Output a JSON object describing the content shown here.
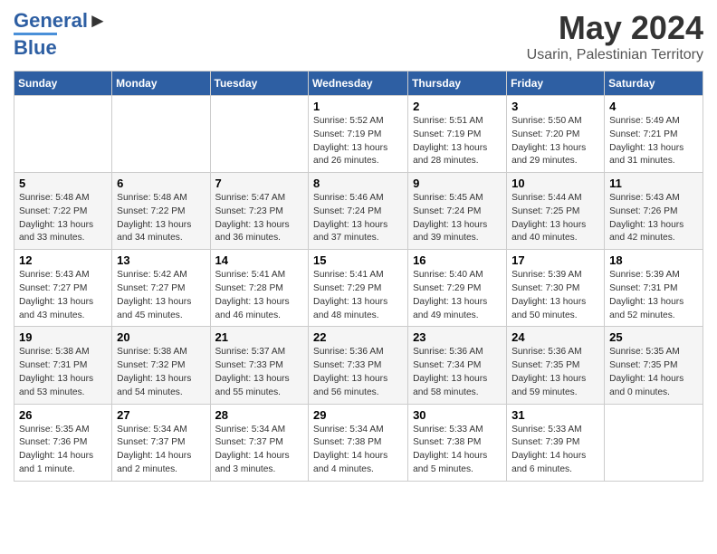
{
  "logo": {
    "line1": "General",
    "line2": "Blue"
  },
  "title": "May 2024",
  "subtitle": "Usarin, Palestinian Territory",
  "days_of_week": [
    "Sunday",
    "Monday",
    "Tuesday",
    "Wednesday",
    "Thursday",
    "Friday",
    "Saturday"
  ],
  "weeks": [
    [
      {
        "day": "",
        "info": ""
      },
      {
        "day": "",
        "info": ""
      },
      {
        "day": "",
        "info": ""
      },
      {
        "day": "1",
        "info": "Sunrise: 5:52 AM\nSunset: 7:19 PM\nDaylight: 13 hours\nand 26 minutes."
      },
      {
        "day": "2",
        "info": "Sunrise: 5:51 AM\nSunset: 7:19 PM\nDaylight: 13 hours\nand 28 minutes."
      },
      {
        "day": "3",
        "info": "Sunrise: 5:50 AM\nSunset: 7:20 PM\nDaylight: 13 hours\nand 29 minutes."
      },
      {
        "day": "4",
        "info": "Sunrise: 5:49 AM\nSunset: 7:21 PM\nDaylight: 13 hours\nand 31 minutes."
      }
    ],
    [
      {
        "day": "5",
        "info": "Sunrise: 5:48 AM\nSunset: 7:22 PM\nDaylight: 13 hours\nand 33 minutes."
      },
      {
        "day": "6",
        "info": "Sunrise: 5:48 AM\nSunset: 7:22 PM\nDaylight: 13 hours\nand 34 minutes."
      },
      {
        "day": "7",
        "info": "Sunrise: 5:47 AM\nSunset: 7:23 PM\nDaylight: 13 hours\nand 36 minutes."
      },
      {
        "day": "8",
        "info": "Sunrise: 5:46 AM\nSunset: 7:24 PM\nDaylight: 13 hours\nand 37 minutes."
      },
      {
        "day": "9",
        "info": "Sunrise: 5:45 AM\nSunset: 7:24 PM\nDaylight: 13 hours\nand 39 minutes."
      },
      {
        "day": "10",
        "info": "Sunrise: 5:44 AM\nSunset: 7:25 PM\nDaylight: 13 hours\nand 40 minutes."
      },
      {
        "day": "11",
        "info": "Sunrise: 5:43 AM\nSunset: 7:26 PM\nDaylight: 13 hours\nand 42 minutes."
      }
    ],
    [
      {
        "day": "12",
        "info": "Sunrise: 5:43 AM\nSunset: 7:27 PM\nDaylight: 13 hours\nand 43 minutes."
      },
      {
        "day": "13",
        "info": "Sunrise: 5:42 AM\nSunset: 7:27 PM\nDaylight: 13 hours\nand 45 minutes."
      },
      {
        "day": "14",
        "info": "Sunrise: 5:41 AM\nSunset: 7:28 PM\nDaylight: 13 hours\nand 46 minutes."
      },
      {
        "day": "15",
        "info": "Sunrise: 5:41 AM\nSunset: 7:29 PM\nDaylight: 13 hours\nand 48 minutes."
      },
      {
        "day": "16",
        "info": "Sunrise: 5:40 AM\nSunset: 7:29 PM\nDaylight: 13 hours\nand 49 minutes."
      },
      {
        "day": "17",
        "info": "Sunrise: 5:39 AM\nSunset: 7:30 PM\nDaylight: 13 hours\nand 50 minutes."
      },
      {
        "day": "18",
        "info": "Sunrise: 5:39 AM\nSunset: 7:31 PM\nDaylight: 13 hours\nand 52 minutes."
      }
    ],
    [
      {
        "day": "19",
        "info": "Sunrise: 5:38 AM\nSunset: 7:31 PM\nDaylight: 13 hours\nand 53 minutes."
      },
      {
        "day": "20",
        "info": "Sunrise: 5:38 AM\nSunset: 7:32 PM\nDaylight: 13 hours\nand 54 minutes."
      },
      {
        "day": "21",
        "info": "Sunrise: 5:37 AM\nSunset: 7:33 PM\nDaylight: 13 hours\nand 55 minutes."
      },
      {
        "day": "22",
        "info": "Sunrise: 5:36 AM\nSunset: 7:33 PM\nDaylight: 13 hours\nand 56 minutes."
      },
      {
        "day": "23",
        "info": "Sunrise: 5:36 AM\nSunset: 7:34 PM\nDaylight: 13 hours\nand 58 minutes."
      },
      {
        "day": "24",
        "info": "Sunrise: 5:36 AM\nSunset: 7:35 PM\nDaylight: 13 hours\nand 59 minutes."
      },
      {
        "day": "25",
        "info": "Sunrise: 5:35 AM\nSunset: 7:35 PM\nDaylight: 14 hours\nand 0 minutes."
      }
    ],
    [
      {
        "day": "26",
        "info": "Sunrise: 5:35 AM\nSunset: 7:36 PM\nDaylight: 14 hours\nand 1 minute."
      },
      {
        "day": "27",
        "info": "Sunrise: 5:34 AM\nSunset: 7:37 PM\nDaylight: 14 hours\nand 2 minutes."
      },
      {
        "day": "28",
        "info": "Sunrise: 5:34 AM\nSunset: 7:37 PM\nDaylight: 14 hours\nand 3 minutes."
      },
      {
        "day": "29",
        "info": "Sunrise: 5:34 AM\nSunset: 7:38 PM\nDaylight: 14 hours\nand 4 minutes."
      },
      {
        "day": "30",
        "info": "Sunrise: 5:33 AM\nSunset: 7:38 PM\nDaylight: 14 hours\nand 5 minutes."
      },
      {
        "day": "31",
        "info": "Sunrise: 5:33 AM\nSunset: 7:39 PM\nDaylight: 14 hours\nand 6 minutes."
      },
      {
        "day": "",
        "info": ""
      }
    ]
  ]
}
